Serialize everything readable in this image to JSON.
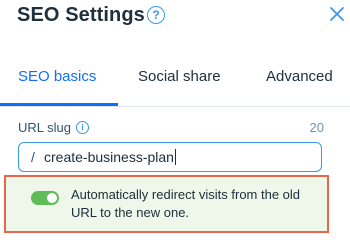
{
  "header": {
    "title": "SEO Settings",
    "help_icon": "help-circle-icon",
    "help_glyph": "?",
    "close_icon": "close-icon"
  },
  "tabs": [
    {
      "label": "SEO basics",
      "active": true
    },
    {
      "label": "Social share",
      "active": false
    },
    {
      "label": "Advanced",
      "active": false
    }
  ],
  "url_slug": {
    "label": "URL slug",
    "info_icon": "info-icon",
    "info_glyph": "i",
    "char_count": "20",
    "prefix": "/",
    "value": "create-business-plan"
  },
  "redirect": {
    "enabled": true,
    "text": "Automatically redirect visits from the old URL to the new one."
  },
  "colors": {
    "accent": "#116dff",
    "toggle_on": "#60bc57",
    "highlight_border": "#e8674a",
    "highlight_bg": "#eef7e9"
  }
}
